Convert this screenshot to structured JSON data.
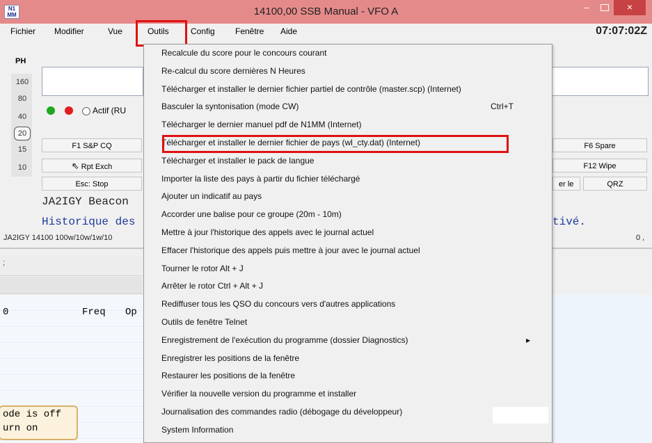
{
  "window": {
    "title": "14100,00 SSB Manual - VFO A",
    "icon_text": "N1 MM",
    "controls": {
      "minimize": "–",
      "close": "×"
    }
  },
  "menubar": {
    "items": [
      "Fichier",
      "Modifier",
      "Vue",
      "Outils",
      "Config",
      "Fenêtre",
      "Aide"
    ],
    "clock": "07:07:02Z"
  },
  "bands": {
    "mode": "PH",
    "list": [
      "160",
      "80",
      "40",
      "20",
      "15",
      "10"
    ],
    "selected": "20"
  },
  "panel": {
    "radio_label": "Actif (RU",
    "f1_label": "F1 S&P CQ",
    "f5_label": "Rpt Exch",
    "esc_label": "Esc: Stop",
    "f6_label": "F6 Spare",
    "f12_label": "F12 Wipe",
    "erle_label": "er le",
    "qrz_label": "QRZ",
    "beacon_text": "JA2IGY Beacon",
    "historique_text": "Historique des",
    "historique_right": "tivé.",
    "status_text": "JA2IGY 14100 100w/10w/1w/10",
    "status_right": "0 ,"
  },
  "log": {
    "strip_char": ";",
    "col_zero": "0",
    "col_freq": "Freq",
    "col_op": "Op",
    "tooltip_line1": "ode is off",
    "tooltip_line2": "urn on"
  },
  "dropdown": {
    "items": [
      {
        "label": "Recalcule du score pour le concours courant"
      },
      {
        "label": "Re-calcul du score dernières N Heures"
      },
      {
        "label": "Télécharger et installer le dernier fichier partiel de contrôle (master.scp) (Internet)"
      },
      {
        "label": "Basculer la syntonisation (mode CW)",
        "shortcut": "Ctrl+T"
      },
      {
        "label": "Télécharger le dernier manuel pdf de N1MM (Internet)"
      },
      {
        "label": "Télécharger et installer le dernier fichier de pays (wl_cty.dat) (Internet)",
        "highlighted": true
      },
      {
        "label": "Télécharger et installer le pack de langue"
      },
      {
        "label": "Importer la liste des pays à partir du fichier téléchargé"
      },
      {
        "label": "Ajouter un indicatif au pays"
      },
      {
        "label": "Accorder une balise pour ce groupe (20m - 10m)"
      },
      {
        "label": "Mettre à jour l'historique des appels avec le journal actuel"
      },
      {
        "label": "Effacer l'historique des appels puis mettre à jour avec le journal actuel"
      },
      {
        "label": "Tourner le rotor Alt + J"
      },
      {
        "label": "Arrêter le rotor Ctrl + Alt + J"
      },
      {
        "label": "Rediffuser tous les QSO du concours vers d'autres applications"
      },
      {
        "label": "Outils de fenêtre Telnet"
      },
      {
        "label": "Enregistrement de l'exécution du programme (dossier Diagnostics)",
        "submenu": true
      },
      {
        "label": "Enregistrer les positions de la fenêtre"
      },
      {
        "label": "Restaurer les positions de la fenêtre"
      },
      {
        "label": "Vérifier la nouvelle version du programme et installer"
      },
      {
        "label": "Journalisation des commandes radio (débogage du développeur)"
      },
      {
        "label": "System Information"
      }
    ]
  },
  "colors": {
    "title_bar": "#e58a8a",
    "close_button": "#c74242",
    "highlight_box": "#e01010",
    "blue_text": "#1f3a9a"
  }
}
